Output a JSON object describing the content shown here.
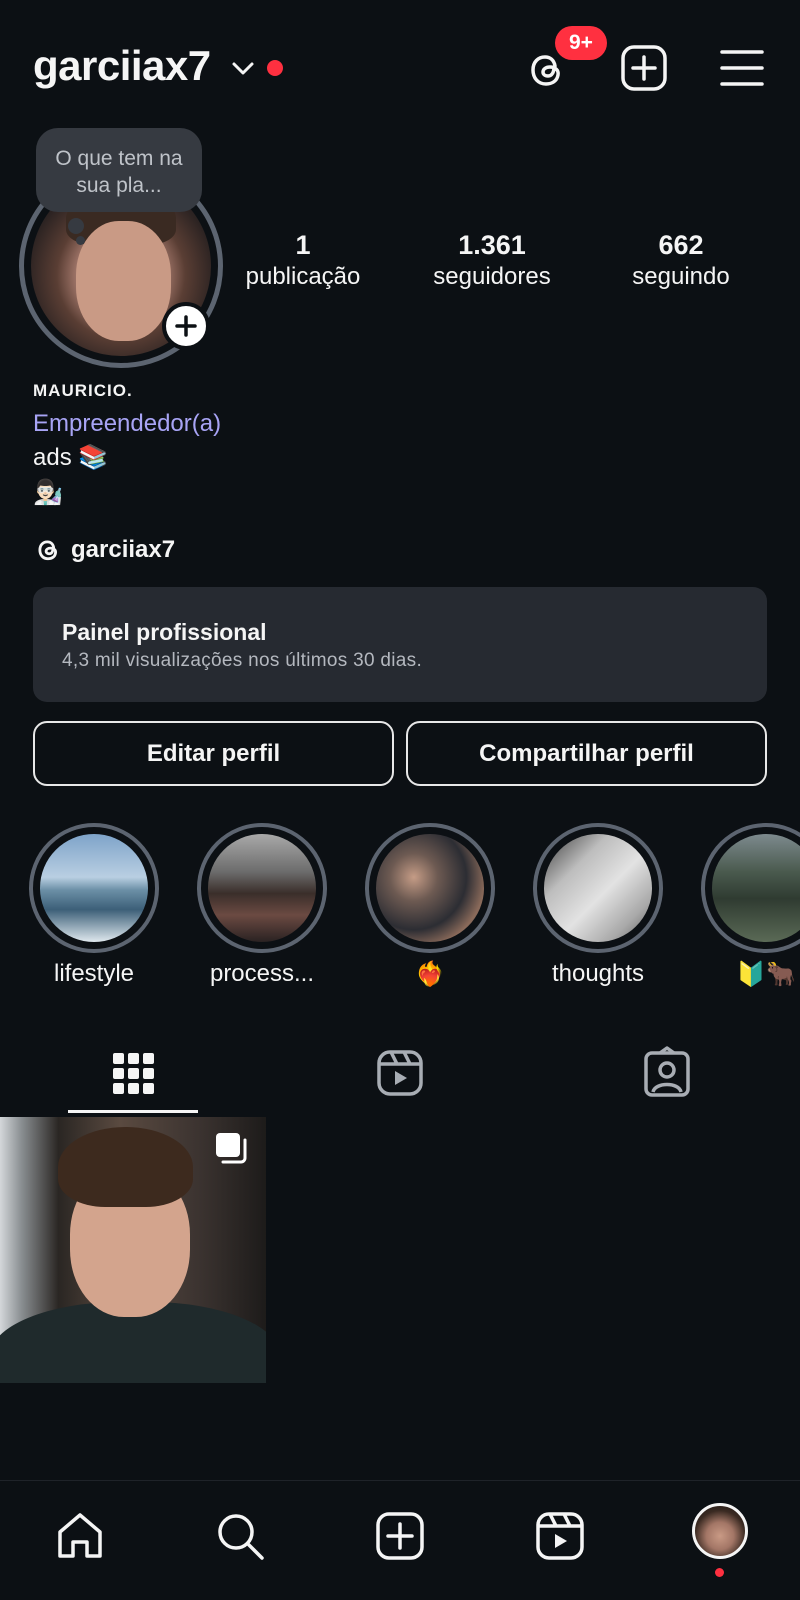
{
  "header": {
    "username": "garciiax7",
    "threads_badge": "9+"
  },
  "profile": {
    "note": "O que tem na sua pla...",
    "stats": [
      {
        "value": "1",
        "label": "publicação"
      },
      {
        "value": "1.361",
        "label": "seguidores"
      },
      {
        "value": "662",
        "label": "seguindo"
      }
    ],
    "full_name": "MAURICIO.",
    "category": "Empreendedor(a)",
    "bio_line1": "ads 📚",
    "bio_line2": "👨🏻‍🔬",
    "threads_handle": "garciiax7"
  },
  "dashboard": {
    "title": "Painel profissional",
    "subtitle": "4,3 mil visualizações nos últimos 30 dias."
  },
  "buttons": {
    "edit": "Editar perfil",
    "share": "Compartilhar perfil"
  },
  "highlights": [
    {
      "label": "lifestyle"
    },
    {
      "label": "process..."
    },
    {
      "label": "❤️‍🔥"
    },
    {
      "label": "thoughts"
    },
    {
      "label": "🔰🐂"
    }
  ],
  "tabs": [
    "grid-icon",
    "reels-icon",
    "tagged-icon"
  ],
  "nav": [
    "home-icon",
    "search-icon",
    "create-icon",
    "reels-icon",
    "profile-avatar"
  ],
  "colors": {
    "background": "#0c1014",
    "accent_red": "#ff3040",
    "category": "#a8a4f5"
  }
}
